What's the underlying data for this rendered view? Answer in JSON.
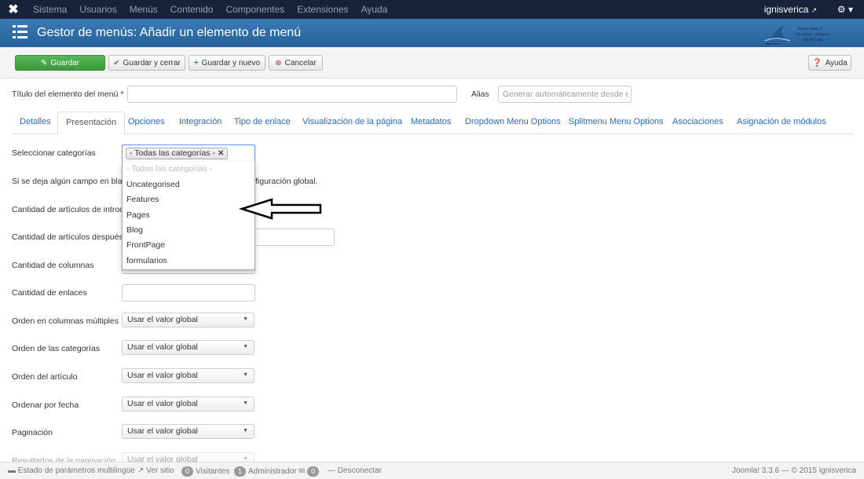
{
  "topnav": {
    "items": [
      "Sistema",
      "Usuarios",
      "Menús",
      "Contenido",
      "Componentes",
      "Extensiones",
      "Ayuda"
    ],
    "user": "ignisverica",
    "gear": "⚙ ▾"
  },
  "header": {
    "title": "Gestor de menús: Añadir un elemento de menú",
    "brand_lines": [
      "Ignisverica",
      "Emilio Valor, 5",
      "Carcaixent · Valencia",
      "605 987 168"
    ]
  },
  "toolbar": {
    "save": "Guardar",
    "save_close": "Guardar y cerrar",
    "save_new": "Guardar y nuevo",
    "cancel": "Cancelar",
    "help": "Ayuda"
  },
  "form": {
    "title_label": "Título del elemento del menú *",
    "title_value": "",
    "alias_label": "Alias",
    "alias_placeholder": "Generar automáticamente desde el"
  },
  "tabs": [
    "Detalles",
    "Presentación",
    "Opciones",
    "Integración",
    "Tipo de enlace",
    "Visualización de la página",
    "Metadatos",
    "Dropdown Menu Options",
    "Splitmenu Menu Options",
    "Asociaciones",
    "Asignación de módulos"
  ],
  "presentation": {
    "select_categories_label": "Seleccionar categorías",
    "selected_tag": "- Todas las categorías -",
    "dropdown_options": [
      "- Todas las categorías -",
      "Uncategorised",
      "Features",
      "Pages",
      "Blog",
      "FrontPage",
      "formularios"
    ],
    "note_left": "Si se deja algún campo en blan",
    "note_right": "figuración global.",
    "intro_articles_label": "Cantidad de artículos de introdu",
    "after_articles_label": "Cantidad de artículos después",
    "columns_label": "Cantidad de columnas",
    "links_label": "Cantidad de enlaces",
    "multi_column_order_label": "Orden en columnas múltiples",
    "category_order_label": "Orden de las categorías",
    "article_order_label": "Orden del artículo",
    "date_order_label": "Ordenar por fecha",
    "pagination_label": "Paginación",
    "pagination_results_label": "Resultados de la paginación",
    "global_value": "Usar el valor global"
  },
  "footer": {
    "multilang": "Estado de parámetros multilingüe",
    "view_site": "Ver sitio",
    "visitors_count": "0",
    "visitors": "Visitantes",
    "admins_count": "1",
    "admins": "Administrador",
    "messages_count": "0",
    "logout": "Desconectar",
    "version": "Joomla! 3.3.6 — © 2015 ignisverica"
  },
  "colors": {
    "navbar": "#17233a",
    "header": "#2d6ea6",
    "save_green": "#46a546",
    "link_blue": "#2a69b8"
  }
}
